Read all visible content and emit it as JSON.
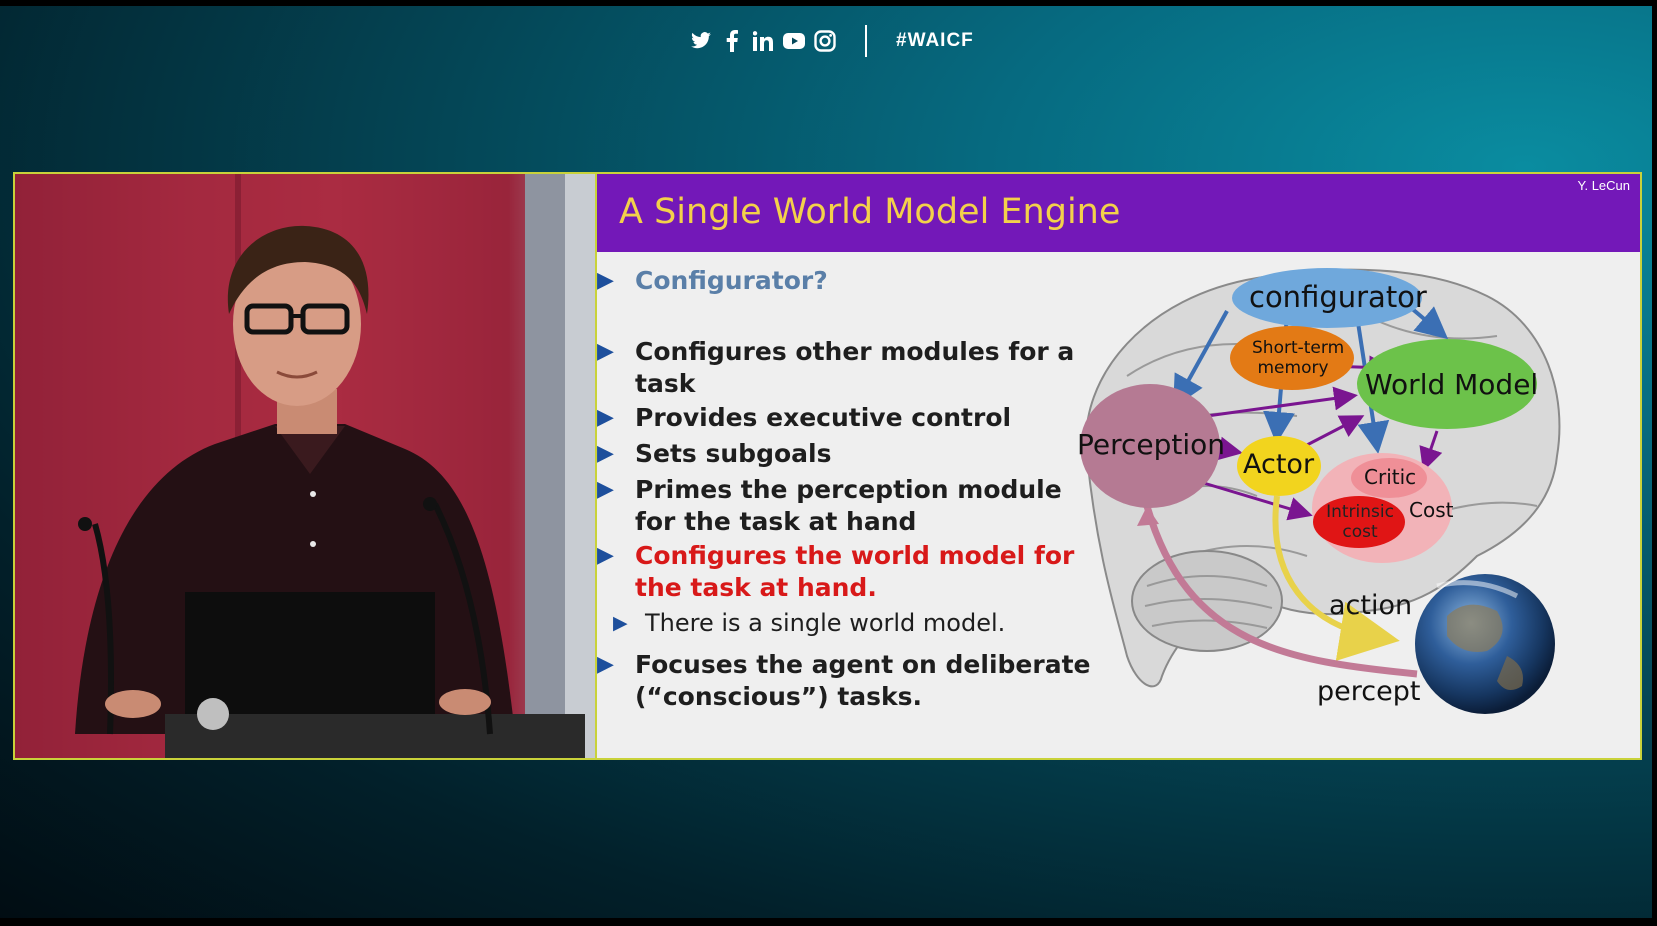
{
  "social": {
    "icons": [
      "twitter-icon",
      "facebook-icon",
      "linkedin-icon",
      "youtube-icon",
      "instagram-icon"
    ],
    "hashtag": "#WAICF"
  },
  "slide": {
    "title": "A Single World Model Engine",
    "credit": "Y. LeCun",
    "bullets": [
      {
        "text": "Configurator?",
        "style": "blue"
      },
      {
        "text_line1": "Configures other modules for a",
        "text_line2": "task",
        "style": "bold"
      },
      {
        "text": "Provides executive control",
        "style": "bold"
      },
      {
        "text": "Sets subgoals",
        "style": "bold"
      },
      {
        "text_line1": "Primes the perception module",
        "text_line2": "for the task at hand",
        "style": "bold"
      },
      {
        "text_line1": "Configures the world model for",
        "text_line2": "the task at hand.",
        "style": "red"
      },
      {
        "text": "There is a single world model.",
        "style": "sub"
      },
      {
        "text_line1": "Focuses the agent on deliberate",
        "text_line2": "(“conscious”) tasks.",
        "style": "bold"
      }
    ],
    "diagram": {
      "configurator": "configurator",
      "short_term_memory_line1": "Short-term",
      "short_term_memory_line2": "memory",
      "world_model": "World Model",
      "perception": "Perception",
      "actor": "Actor",
      "critic": "Critic",
      "cost": "Cost",
      "intrinsic_cost_line1": "Intrinsic",
      "intrinsic_cost_line2": "cost",
      "action": "action",
      "percept": "percept"
    }
  },
  "colors": {
    "title_bar": "#7318b8",
    "title_text": "#f3d14a",
    "bullet_arrow": "#1d4f9c",
    "highlight_red": "#d81919",
    "border": "#c9d23a"
  }
}
